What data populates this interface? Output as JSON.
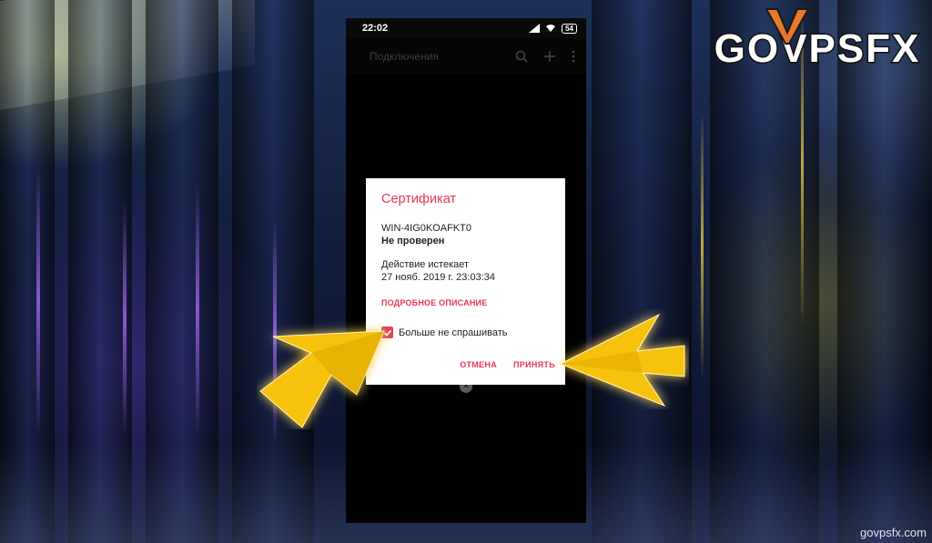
{
  "logo": {
    "text": "GOVPSFX"
  },
  "watermark": {
    "text": "govpsfx.com"
  },
  "phone": {
    "status_bar": {
      "time": "22:02",
      "battery": "54"
    },
    "app_bar": {
      "title": "Подключения"
    }
  },
  "dialog": {
    "title": "Сертификат",
    "host": "WIN-4IG0KOAFKT0",
    "status": "Не проверен",
    "expires_label": "Действие истекает",
    "expires_value": "27 нояб. 2019 г. 23:03:34",
    "details_link": "ПОДРОБНОЕ ОПИСАНИЕ",
    "dont_ask_label": "Больше не спрашивать",
    "dont_ask_checked": true,
    "cancel_label": "ОТМЕНА",
    "accept_label": "ПРИНЯТЬ"
  },
  "colors": {
    "accent": "#e8374f",
    "arrow": "#f6c20f"
  }
}
